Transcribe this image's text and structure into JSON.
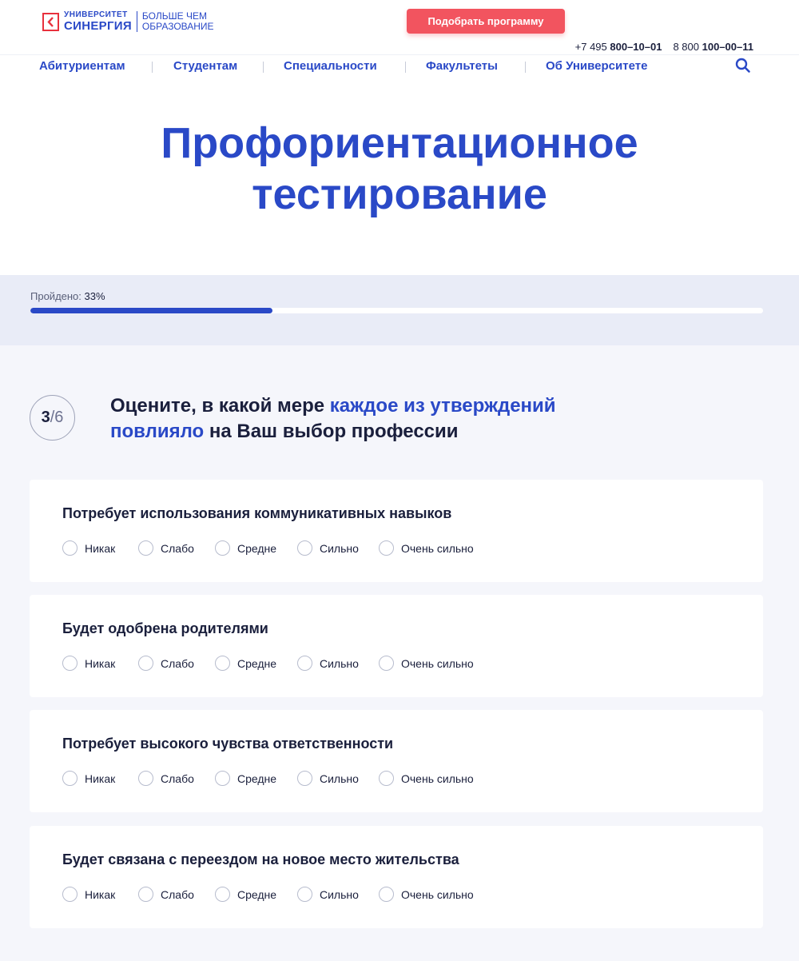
{
  "header": {
    "logo": {
      "line1": "УНИВЕРСИТЕТ",
      "line2": "СИНЕРГИЯ",
      "slogan1": "БОЛЬШЕ ЧЕМ",
      "slogan2": "ОБРАЗОВАНИЕ"
    },
    "cta_label": "Подобрать программу",
    "phones": [
      {
        "prefix": "+7 495",
        "number": "800–10–01"
      },
      {
        "prefix": "8 800",
        "number": "100–00–11"
      }
    ],
    "nav": [
      "Абитуриентам",
      "Студентам",
      "Специальности",
      "Факультеты",
      "Об Университете"
    ]
  },
  "page_title_line1": "Профориентационное",
  "page_title_line2": "тестирование",
  "progress": {
    "label": "Пройдено:",
    "value_text": "33%",
    "fraction": 0.33
  },
  "step": {
    "current": "3",
    "separator": "/",
    "total": "6"
  },
  "question": {
    "part1": "Оцените, в какой мере ",
    "highlight": "каждое из утверждений повлияло",
    "part2": " на Ваш выбор профессии"
  },
  "options": [
    "Никак",
    "Слабо",
    "Средне",
    "Сильно",
    "Очень сильно"
  ],
  "statements": [
    "Потребует использования коммуникативных навыков",
    "Будет одобрена родителями",
    "Потребует высокого чувства ответственности",
    "Будет связана с переездом на новое место жительства"
  ],
  "colors": {
    "brand_blue": "#2a49c7",
    "accent_red": "#f2545f",
    "text_dark": "#1a1f3c"
  },
  "icons": {
    "logo": "synergy-logo-icon",
    "search": "search-icon",
    "radio": "radio-empty-icon"
  }
}
